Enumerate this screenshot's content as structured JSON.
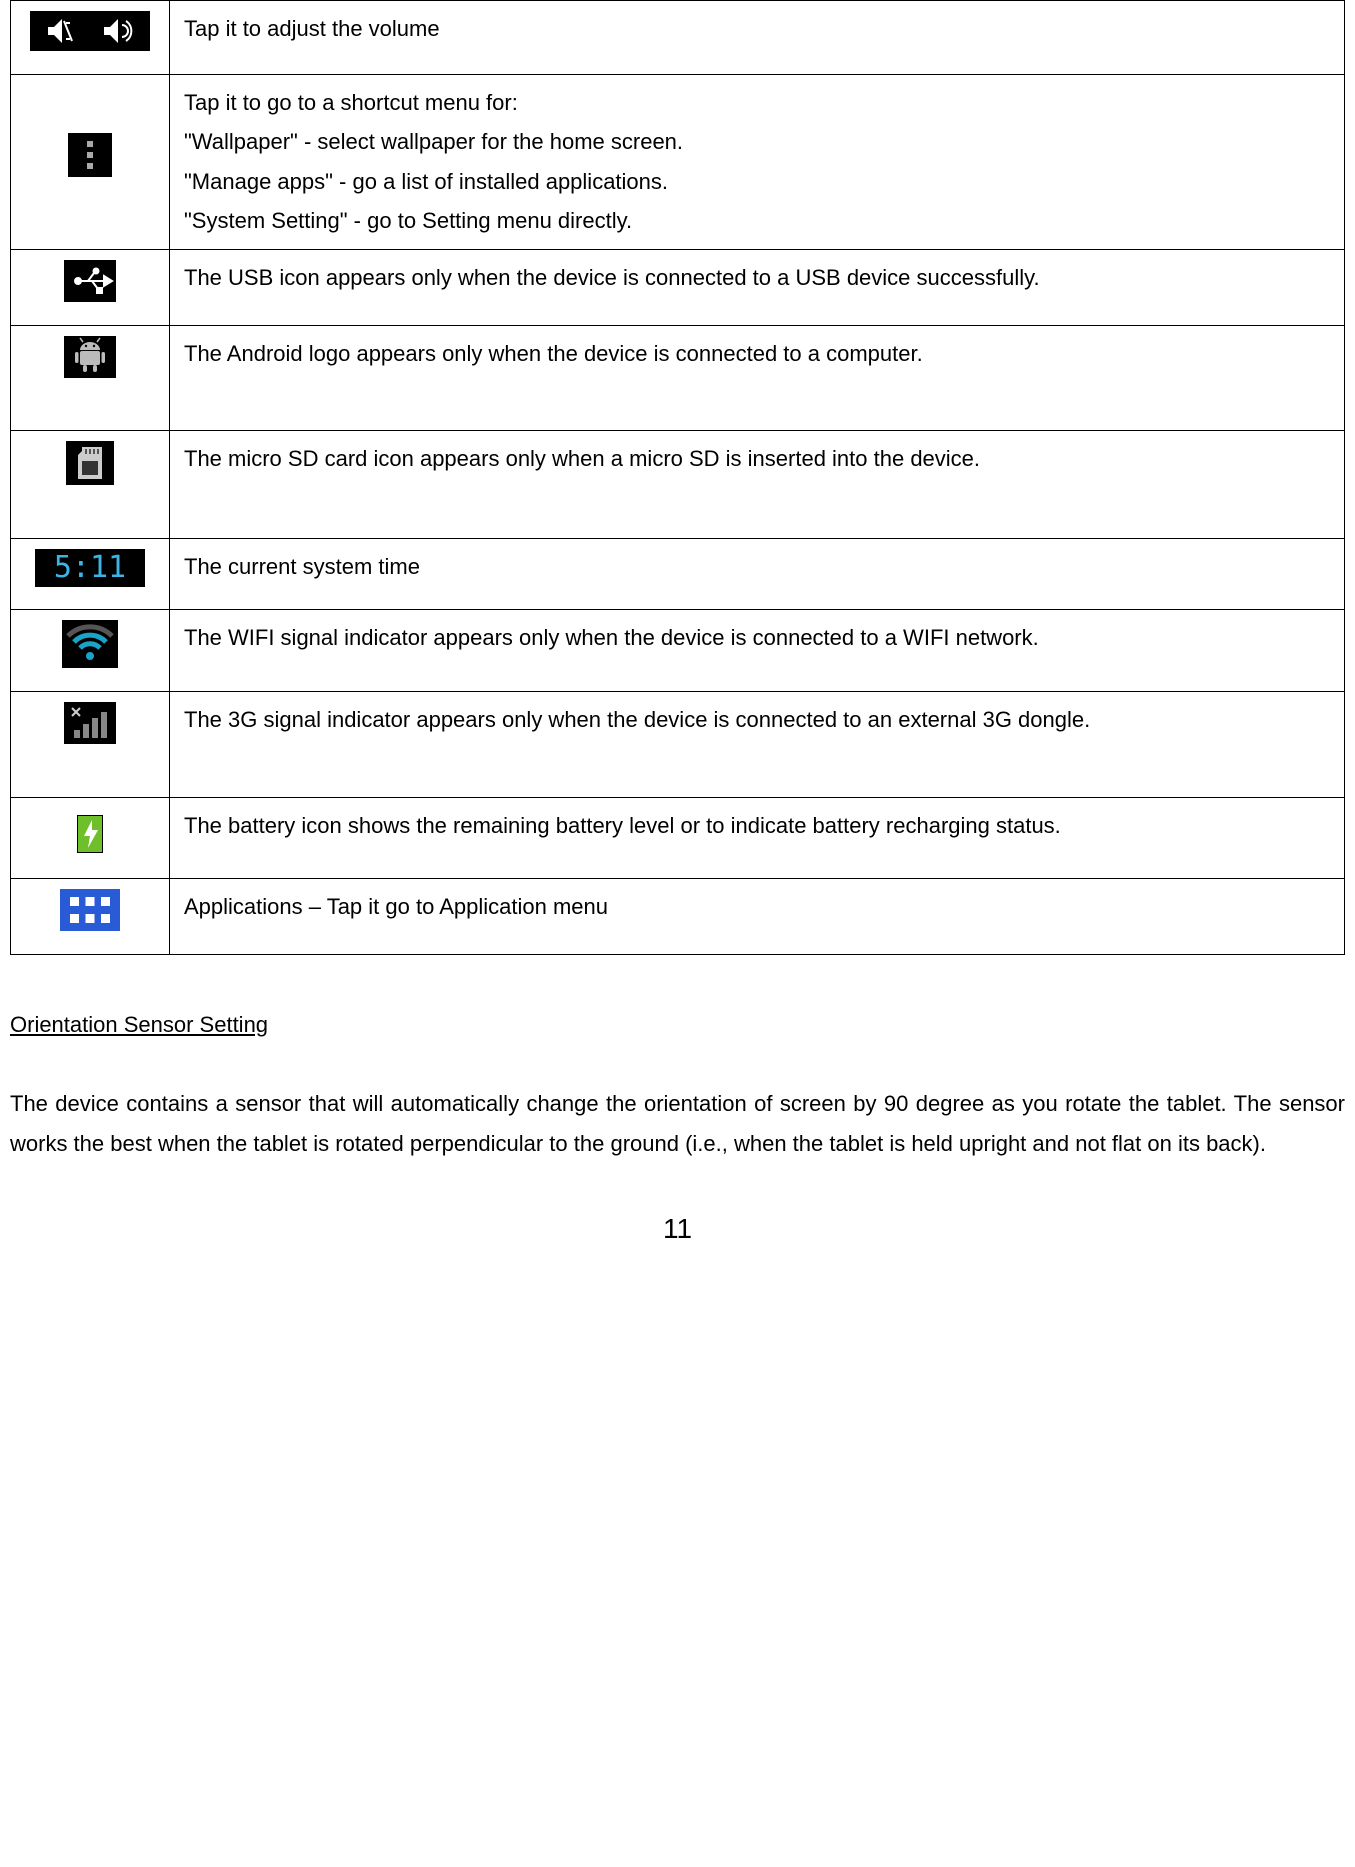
{
  "rows": {
    "volume": "Tap it to adjust the volume",
    "shortcut_intro": "Tap it to go to a shortcut menu for:",
    "shortcut_wallpaper": "\"Wallpaper\" - select wallpaper for the home screen.",
    "shortcut_manage": "\"Manage apps\" - go a list of installed applications.",
    "shortcut_system": "\"System Setting\" - go to Setting menu directly.",
    "usb": "The USB icon appears only when the device is connected to a USB device successfully.",
    "android": "The Android logo appears only when the device is connected to a computer.",
    "sd": "The micro SD card icon appears only when a micro SD is inserted into the device.",
    "time": "The current system time",
    "wifi": "The WIFI signal indicator appears only when the device is connected to a WIFI network.",
    "threeg": "The 3G signal indicator appears only when the device is connected to an external 3G dongle.",
    "battery": "The battery icon shows the remaining battery level or to indicate battery recharging status.",
    "apps": "Applications – Tap it go to Application menu"
  },
  "heading": "Orientation Sensor Setting",
  "paragraph": "The device contains a sensor that will automatically change the orientation of screen by 90 degree as you rotate the tablet.   The sensor works the best when the tablet is rotated perpendicular to the ground (i.e., when the tablet is held upright and not flat on its back).",
  "page_number": "11",
  "time_label": "5:11"
}
